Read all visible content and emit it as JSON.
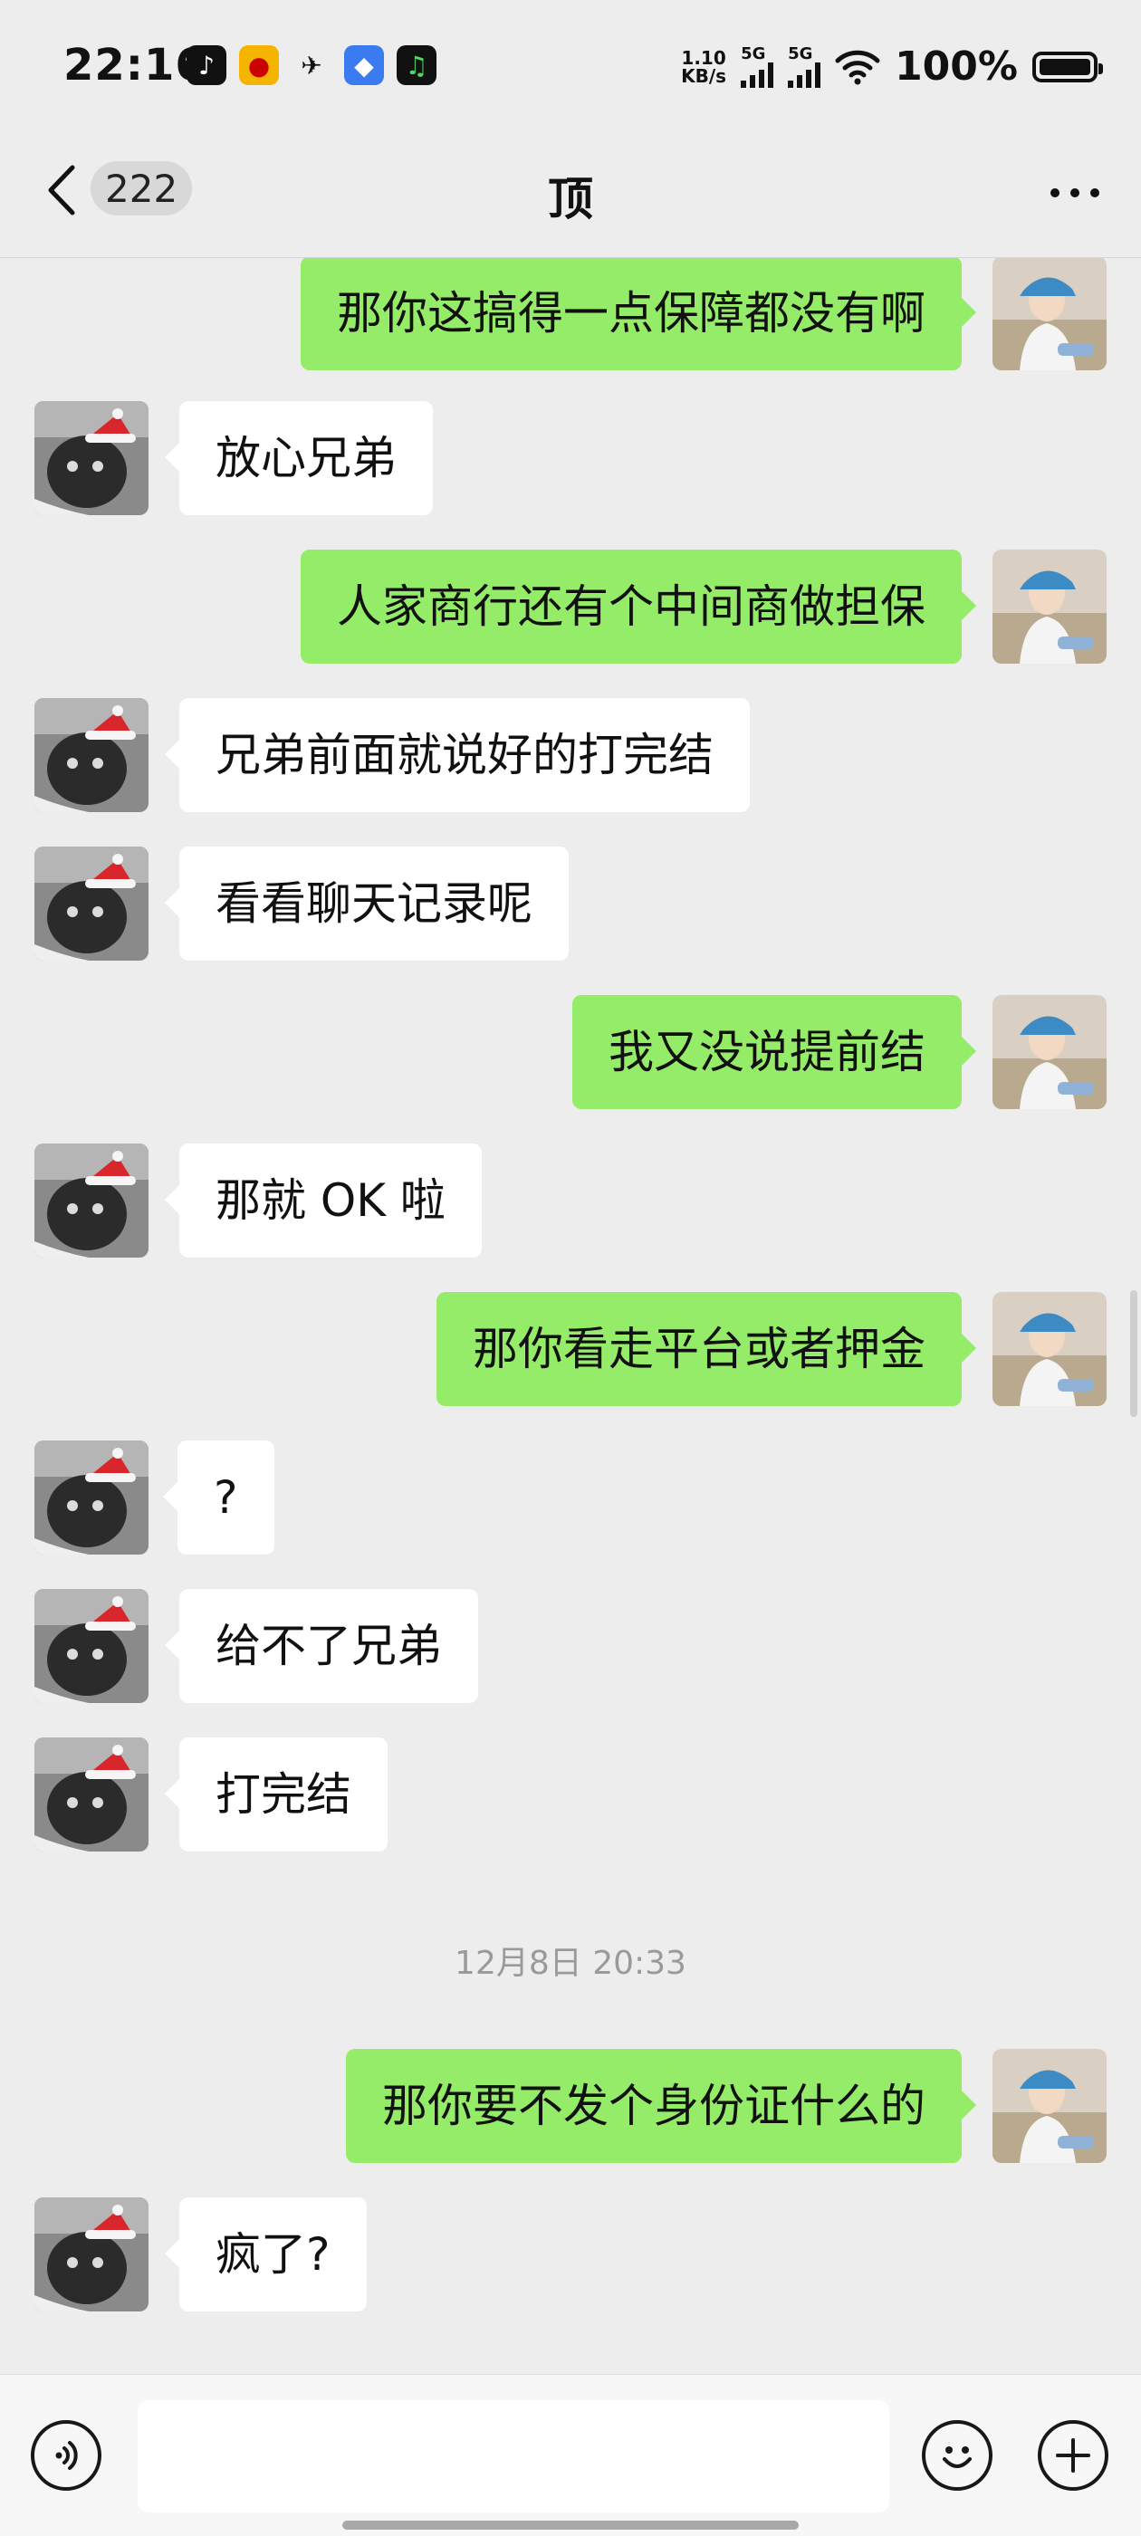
{
  "status_bar": {
    "time": "22:16",
    "net_speed_value": "1.10",
    "net_speed_unit": "KB/s",
    "signal1_label": "5G",
    "signal2_label": "5G",
    "battery": "100%"
  },
  "header": {
    "back_count": "222",
    "title": "顶",
    "more_icon": "more-dots-icon"
  },
  "messages": [
    {
      "side": "out",
      "text": "那你这搞得一点保障都没有啊"
    },
    {
      "side": "in",
      "text": "放心兄弟"
    },
    {
      "side": "out",
      "text": "人家商行还有个中间商做担保"
    },
    {
      "side": "in",
      "text": "兄弟前面就说好的打完结"
    },
    {
      "side": "in",
      "text": "看看聊天记录呢"
    },
    {
      "side": "out",
      "text": "我又没说提前结"
    },
    {
      "side": "in",
      "text": "那就 OK 啦"
    },
    {
      "side": "out",
      "text": "那你看走平台或者押金"
    },
    {
      "side": "in",
      "text": "?"
    },
    {
      "side": "in",
      "text": "给不了兄弟"
    },
    {
      "side": "in",
      "text": "打完结"
    },
    {
      "side": "out",
      "text": "那你要不发个身份证什么的"
    },
    {
      "side": "in",
      "text": "疯了?"
    }
  ],
  "timestamp": "12月8日 20:33",
  "input": {
    "value": "",
    "voice_icon": "voice-icon",
    "emoji_icon": "emoji-icon",
    "plus_icon": "plus-icon"
  },
  "colors": {
    "background": "#ededed",
    "outgoing_bubble": "#95ec69",
    "incoming_bubble": "#ffffff"
  }
}
